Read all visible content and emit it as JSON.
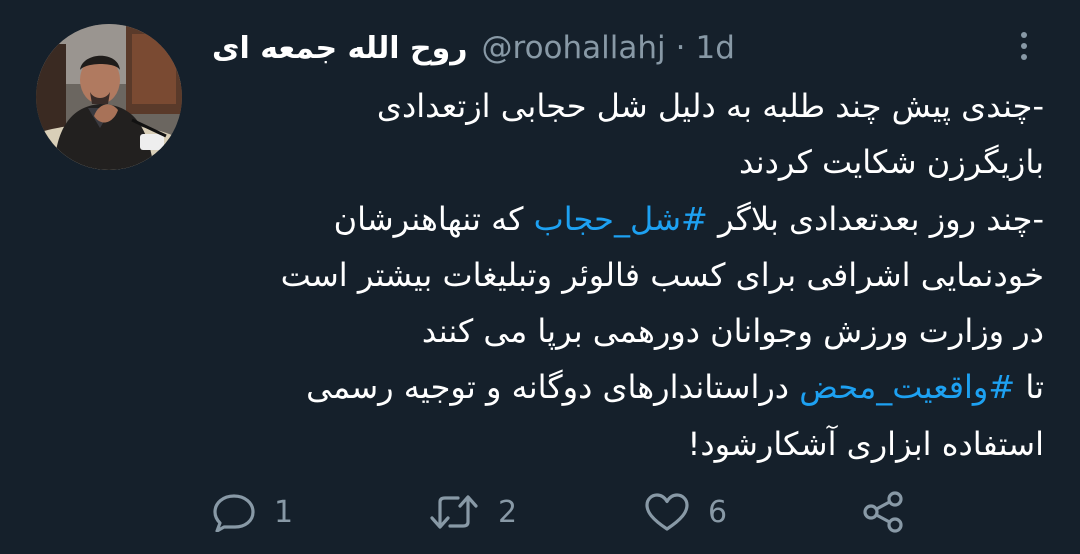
{
  "tweet": {
    "display_name": "روح الله جمعه ای",
    "handle": "@roohallahj",
    "separator": "·",
    "time": "1d",
    "body_lines": [
      [
        {
          "text": "-چندی پیش چند طلبه به دلیل شل حجابی ازتعدادی"
        }
      ],
      [
        {
          "text": "بازیگرزن شکایت کردند"
        }
      ],
      [
        {
          "text": "-چند روز بعدتعدادی بلاگر "
        },
        {
          "text": "#شل_حجاب",
          "hashtag": true
        },
        {
          "text": " که تنهاهنرشان"
        }
      ],
      [
        {
          "text": "خودنمایی اشرافی برای کسب فالوئر وتبلیغات بیشتر است"
        }
      ],
      [
        {
          "text": "در وزارت ورزش وجوانان دورهمی برپا می کنند"
        }
      ],
      [
        {
          "text": "تا "
        },
        {
          "text": "#واقعیت_محض",
          "hashtag": true
        },
        {
          "text": " دراستاندارهای دوگانه و توجیه رسمی"
        }
      ],
      [
        {
          "text": "استفاده ابزاری آشکارشود!"
        }
      ]
    ]
  },
  "actions": {
    "reply_count": "1",
    "retweet_count": "2",
    "like_count": "6"
  },
  "colors": {
    "background": "#15202b",
    "text": "#ffffff",
    "muted": "#8899a6",
    "accent": "#1da1f2"
  },
  "icons": {
    "reply": "reply-icon",
    "retweet": "retweet-icon",
    "like": "heart-icon",
    "share": "share-icon",
    "more": "more-vertical-icon"
  }
}
